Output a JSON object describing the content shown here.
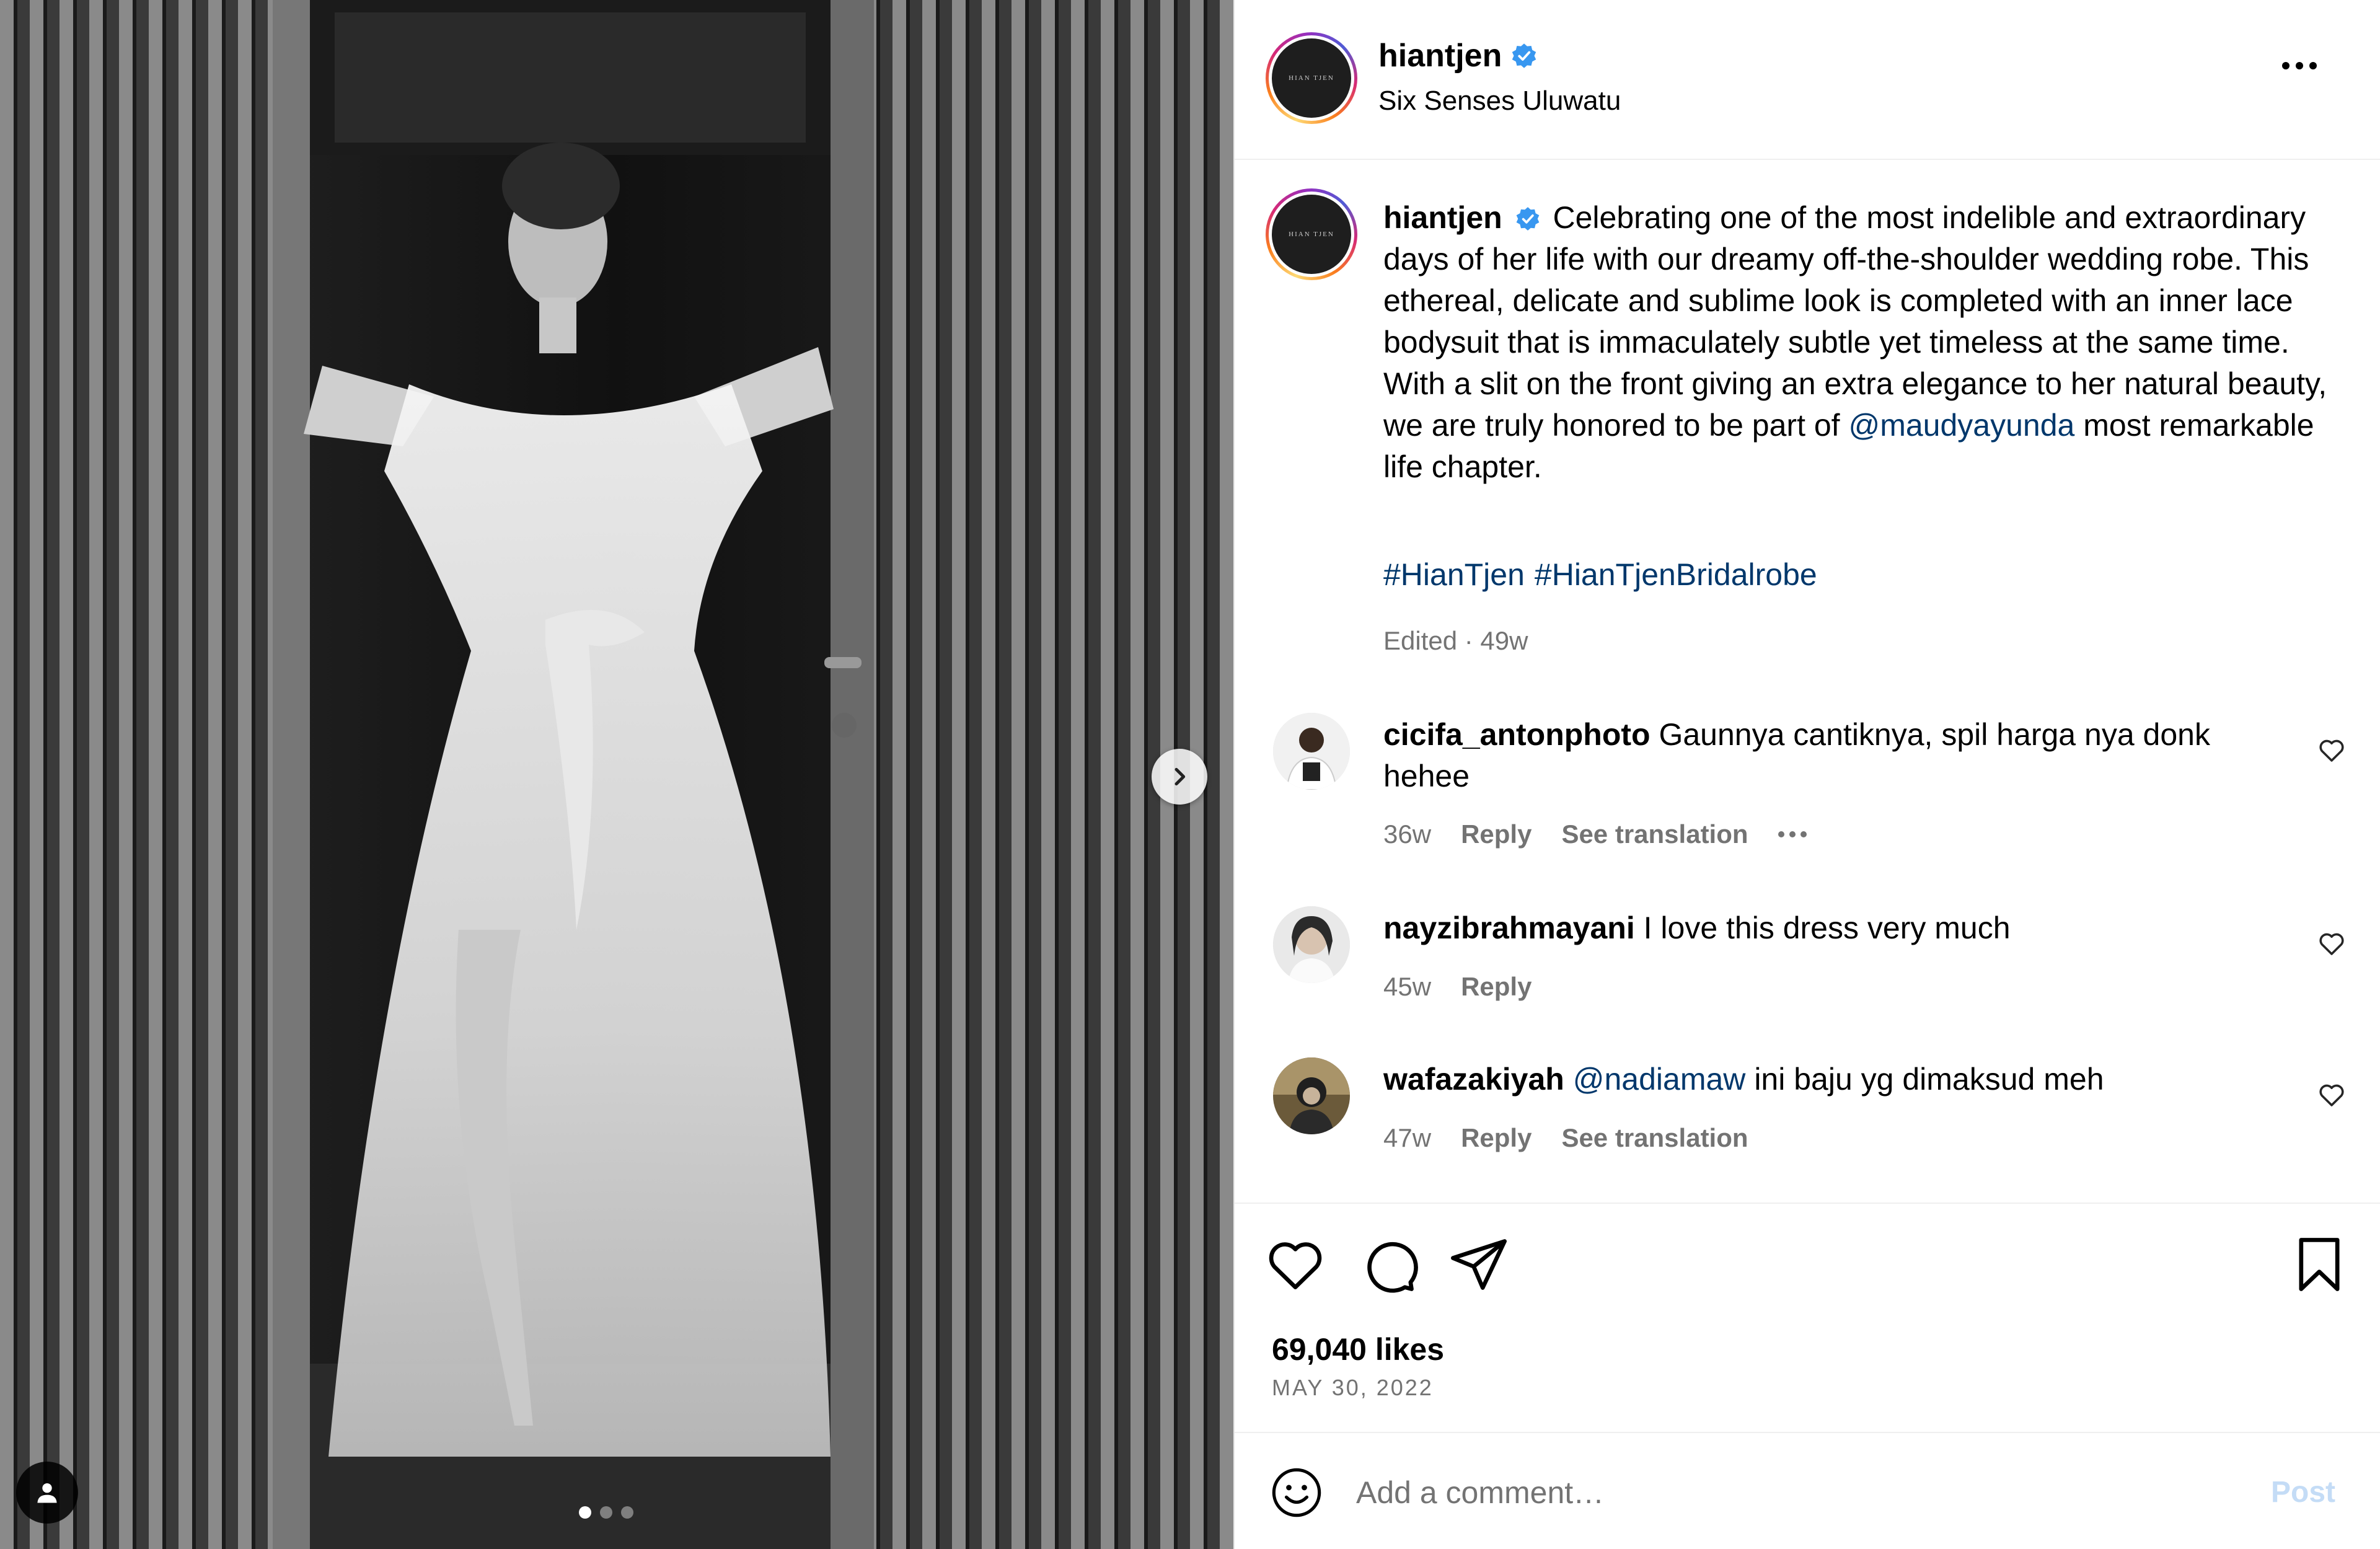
{
  "post": {
    "username": "hiantjen",
    "location": "Six Senses Uluwatu",
    "avatar_text": "HIAN TJEN",
    "verified_icon": "verified-badge-icon",
    "caption_text": "Celebrating one of the most indelible and extraordinary days of her life with our dreamy off-the-shoulder wedding robe. This ethereal, delicate and sublime look is completed with an inner lace bodysuit that is immaculately subtle yet timeless at the same time. With a slit on the front giving an extra elegance to her natural beauty, we are truly honored to be part of",
    "caption_mention": "@maudyayunda",
    "caption_tail": "most remarkable life chapter.",
    "hashtags": [
      "#HianTjen",
      "#HianTjenBridalrobe"
    ],
    "edited": "Edited · 49w",
    "likes": "69,040 likes",
    "date": "MAY 30, 2022"
  },
  "media": {
    "carousel_count": 3,
    "active_index": 0
  },
  "comments": [
    {
      "username": "cicifa_antonphoto",
      "text": "Gaunnya cantiknya, spil harga nya donk hehee",
      "age": "36w",
      "reply": "Reply",
      "translate": "See translation",
      "has_more": true
    },
    {
      "username": "nayzibrahmayani",
      "text": "I love this dress very much",
      "age": "45w",
      "reply": "Reply"
    },
    {
      "username": "wafazakiyah",
      "mention": "@nadiamaw",
      "text": "ini baju yg dimaksud meh",
      "age": "47w",
      "reply": "Reply",
      "translate": "See translation"
    }
  ],
  "composer": {
    "placeholder": "Add a comment…",
    "post_label": "Post"
  },
  "colors": {
    "link": "#00376b",
    "muted": "#737373",
    "verified": "#3897f0",
    "post_disabled": "#c4dcf6"
  },
  "icons": [
    "heart-icon",
    "comment-icon",
    "share-icon",
    "bookmark-icon",
    "emoji-icon",
    "chevron-right-icon",
    "user-tag-icon",
    "more-icon"
  ]
}
